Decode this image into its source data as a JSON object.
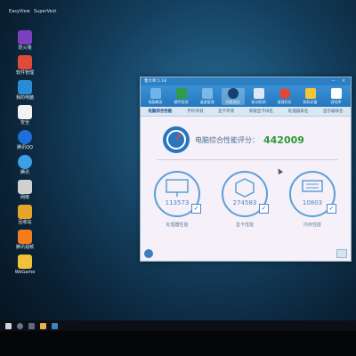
{
  "desktop": {
    "top_labels": [
      "EasyView",
      "SuperVest"
    ],
    "icons": [
      {
        "label": "防火墙",
        "color": "#7b3fbf",
        "icon": "shield-icon"
      },
      {
        "label": "软件管理",
        "color": "#e04a3a",
        "icon": "apps-icon"
      },
      {
        "label": "我的电脑",
        "color": "#2c8bd6",
        "icon": "computer-icon"
      },
      {
        "label": "安全",
        "color": "#f2f2f2",
        "icon": "chart-icon"
      },
      {
        "label": "腾讯QQ",
        "color": "#1e6fd9",
        "icon": "qq-icon"
      },
      {
        "label": "腾讯",
        "color": "#3aa0e8",
        "icon": "tencent-icon"
      },
      {
        "label": "网络",
        "color": "#d0d0d0",
        "icon": "network-icon"
      },
      {
        "label": "回收站",
        "color": "#e8a52c",
        "icon": "recycle-icon"
      },
      {
        "label": "腾讯视频",
        "color": "#f37c1e",
        "icon": "video-icon"
      },
      {
        "label": "WeGame",
        "color": "#f0c23a",
        "icon": "wegame-icon"
      }
    ]
  },
  "window": {
    "title": "鲁大师 5.18",
    "title_buttons": "— ✕",
    "toolbar": [
      {
        "label": "电脑概览",
        "color": "#6fb4ea",
        "icon": "monitor-icon"
      },
      {
        "label": "硬件检测",
        "color": "#2f9c4a",
        "icon": "chip-icon"
      },
      {
        "label": "温度管理",
        "color": "#7ab8ea",
        "icon": "temperature-icon"
      },
      {
        "label": "性能测试",
        "color": "#16406e",
        "icon": "speedometer-icon"
      },
      {
        "label": "驱动检测",
        "color": "#dfe8f2",
        "icon": "driver-icon"
      },
      {
        "label": "清理优化",
        "color": "#e0473b",
        "icon": "clean-icon"
      },
      {
        "label": "装机必备",
        "color": "#f2c53a",
        "icon": "apps-icon"
      },
      {
        "label": "游戏库",
        "color": "#ffffff",
        "icon": "gamepad-icon"
      }
    ],
    "tabs": [
      "电脑综合性能",
      "手机评测",
      "显卡评测",
      "新版显卡排名",
      "处理器排名",
      "显示器排名"
    ],
    "score_label": "电脑综合性能评分：",
    "score_value": "442009",
    "categories": [
      {
        "value": "113573",
        "label": "处理器性能",
        "icon": "cpu-icon"
      },
      {
        "value": "274583",
        "label": "显卡性能",
        "icon": "gpu-icon"
      },
      {
        "value": "10803",
        "label": "内存性能",
        "icon": "memory-icon"
      }
    ],
    "check_mark": "✓"
  }
}
